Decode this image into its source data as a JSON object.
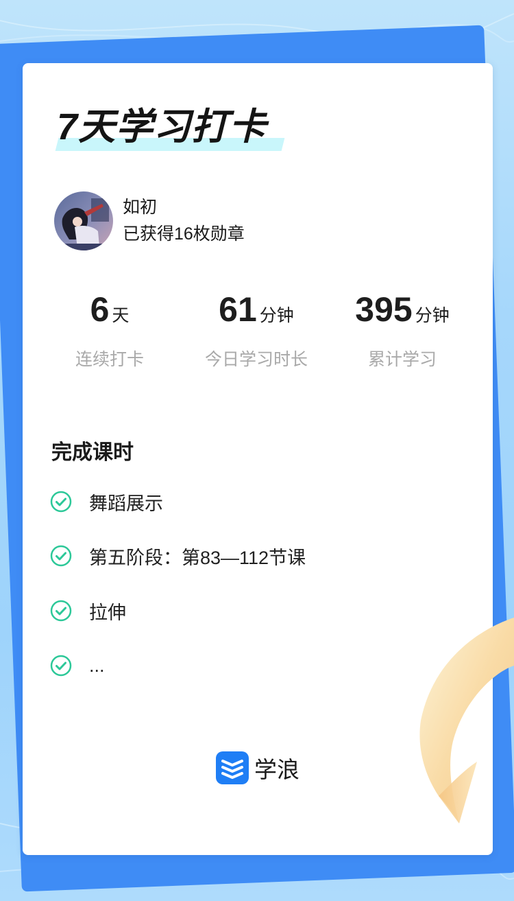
{
  "header": {
    "title": "7天学习打卡"
  },
  "user": {
    "name": "如初",
    "badges_text": "已获得16枚勋章"
  },
  "stats": [
    {
      "value": "6",
      "unit": "天",
      "label": "连续打卡"
    },
    {
      "value": "61",
      "unit": "分钟",
      "label": "今日学习时长"
    },
    {
      "value": "395",
      "unit": "分钟",
      "label": "累计学习"
    }
  ],
  "lessons": {
    "title": "完成课时",
    "items": [
      {
        "label": "舞蹈展示"
      },
      {
        "label": "第五阶段：第83—112节课"
      },
      {
        "label": "拉伸"
      },
      {
        "label": "..."
      }
    ]
  },
  "brand": {
    "name": "学浪",
    "logo_icon": "xuelang-logo-icon"
  },
  "colors": {
    "check_green": "#2cc898",
    "brand_blue": "#1f7ef5",
    "back_card_blue": "#3f8cf5",
    "title_highlight": "#c9f6fb",
    "label_gray": "#a9a9a9"
  }
}
